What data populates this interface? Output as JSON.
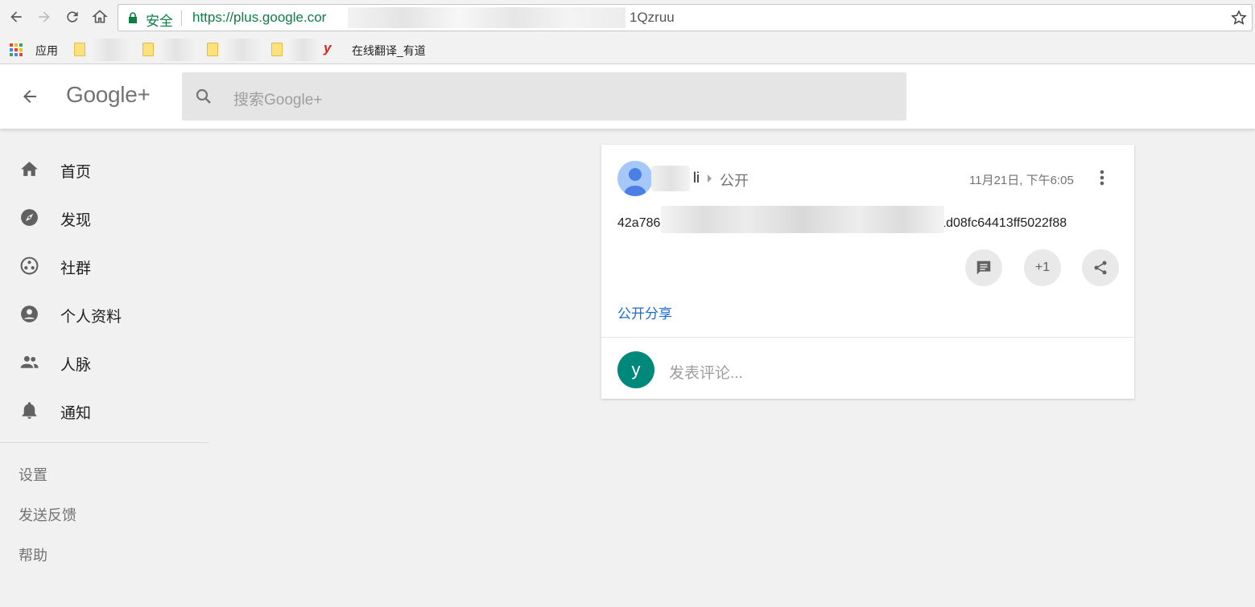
{
  "browser": {
    "secure_label": "安全",
    "url_visible_start": "https://plus.google.cor",
    "url_visible_end": "1Qzruu",
    "bookmarks": {
      "apps_label": "应用",
      "youdao_label": "在线翻译_有道"
    }
  },
  "header": {
    "logo": "Google+",
    "search_placeholder": "搜索Google+"
  },
  "sidebar": {
    "items": [
      {
        "label": "首页",
        "icon": "home-icon"
      },
      {
        "label": "发现",
        "icon": "compass-icon"
      },
      {
        "label": "社群",
        "icon": "communities-icon"
      },
      {
        "label": "个人资料",
        "icon": "profile-icon"
      },
      {
        "label": "人脉",
        "icon": "people-icon"
      },
      {
        "label": "通知",
        "icon": "bell-icon"
      }
    ],
    "links": [
      "设置",
      "发送反馈",
      "帮助"
    ]
  },
  "post": {
    "author_visible": "li",
    "visibility": "公开",
    "timestamp": "11月21日, 下午6:05",
    "text_start": "42a786",
    "text_end": "881d08fc64413ff5022f88",
    "plus_one": "+1",
    "share_link": "公开分享",
    "commenter_initial": "y",
    "comment_placeholder": "发表评论..."
  },
  "colors": {
    "secure_green": "#0b8043",
    "link_blue": "#1a6dd5",
    "commenter_teal": "#00897b",
    "avatar_blue": "#a5c8f8"
  }
}
